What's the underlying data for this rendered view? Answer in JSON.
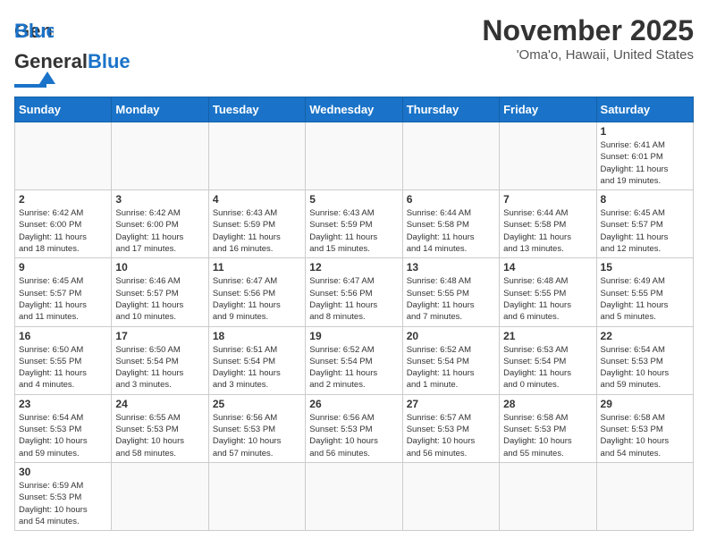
{
  "header": {
    "logo_text_normal": "General",
    "logo_text_blue": "Blue",
    "title": "November 2025",
    "subtitle": "'Oma'o, Hawaii, United States"
  },
  "weekdays": [
    "Sunday",
    "Monday",
    "Tuesday",
    "Wednesday",
    "Thursday",
    "Friday",
    "Saturday"
  ],
  "weeks": [
    [
      {
        "day": "",
        "info": ""
      },
      {
        "day": "",
        "info": ""
      },
      {
        "day": "",
        "info": ""
      },
      {
        "day": "",
        "info": ""
      },
      {
        "day": "",
        "info": ""
      },
      {
        "day": "",
        "info": ""
      },
      {
        "day": "1",
        "info": "Sunrise: 6:41 AM\nSunset: 6:01 PM\nDaylight: 11 hours\nand 19 minutes."
      }
    ],
    [
      {
        "day": "2",
        "info": "Sunrise: 6:42 AM\nSunset: 6:00 PM\nDaylight: 11 hours\nand 18 minutes."
      },
      {
        "day": "3",
        "info": "Sunrise: 6:42 AM\nSunset: 6:00 PM\nDaylight: 11 hours\nand 17 minutes."
      },
      {
        "day": "4",
        "info": "Sunrise: 6:43 AM\nSunset: 5:59 PM\nDaylight: 11 hours\nand 16 minutes."
      },
      {
        "day": "5",
        "info": "Sunrise: 6:43 AM\nSunset: 5:59 PM\nDaylight: 11 hours\nand 15 minutes."
      },
      {
        "day": "6",
        "info": "Sunrise: 6:44 AM\nSunset: 5:58 PM\nDaylight: 11 hours\nand 14 minutes."
      },
      {
        "day": "7",
        "info": "Sunrise: 6:44 AM\nSunset: 5:58 PM\nDaylight: 11 hours\nand 13 minutes."
      },
      {
        "day": "8",
        "info": "Sunrise: 6:45 AM\nSunset: 5:57 PM\nDaylight: 11 hours\nand 12 minutes."
      }
    ],
    [
      {
        "day": "9",
        "info": "Sunrise: 6:45 AM\nSunset: 5:57 PM\nDaylight: 11 hours\nand 11 minutes."
      },
      {
        "day": "10",
        "info": "Sunrise: 6:46 AM\nSunset: 5:57 PM\nDaylight: 11 hours\nand 10 minutes."
      },
      {
        "day": "11",
        "info": "Sunrise: 6:47 AM\nSunset: 5:56 PM\nDaylight: 11 hours\nand 9 minutes."
      },
      {
        "day": "12",
        "info": "Sunrise: 6:47 AM\nSunset: 5:56 PM\nDaylight: 11 hours\nand 8 minutes."
      },
      {
        "day": "13",
        "info": "Sunrise: 6:48 AM\nSunset: 5:55 PM\nDaylight: 11 hours\nand 7 minutes."
      },
      {
        "day": "14",
        "info": "Sunrise: 6:48 AM\nSunset: 5:55 PM\nDaylight: 11 hours\nand 6 minutes."
      },
      {
        "day": "15",
        "info": "Sunrise: 6:49 AM\nSunset: 5:55 PM\nDaylight: 11 hours\nand 5 minutes."
      }
    ],
    [
      {
        "day": "16",
        "info": "Sunrise: 6:50 AM\nSunset: 5:55 PM\nDaylight: 11 hours\nand 4 minutes."
      },
      {
        "day": "17",
        "info": "Sunrise: 6:50 AM\nSunset: 5:54 PM\nDaylight: 11 hours\nand 3 minutes."
      },
      {
        "day": "18",
        "info": "Sunrise: 6:51 AM\nSunset: 5:54 PM\nDaylight: 11 hours\nand 3 minutes."
      },
      {
        "day": "19",
        "info": "Sunrise: 6:52 AM\nSunset: 5:54 PM\nDaylight: 11 hours\nand 2 minutes."
      },
      {
        "day": "20",
        "info": "Sunrise: 6:52 AM\nSunset: 5:54 PM\nDaylight: 11 hours\nand 1 minute."
      },
      {
        "day": "21",
        "info": "Sunrise: 6:53 AM\nSunset: 5:54 PM\nDaylight: 11 hours\nand 0 minutes."
      },
      {
        "day": "22",
        "info": "Sunrise: 6:54 AM\nSunset: 5:53 PM\nDaylight: 10 hours\nand 59 minutes."
      }
    ],
    [
      {
        "day": "23",
        "info": "Sunrise: 6:54 AM\nSunset: 5:53 PM\nDaylight: 10 hours\nand 59 minutes."
      },
      {
        "day": "24",
        "info": "Sunrise: 6:55 AM\nSunset: 5:53 PM\nDaylight: 10 hours\nand 58 minutes."
      },
      {
        "day": "25",
        "info": "Sunrise: 6:56 AM\nSunset: 5:53 PM\nDaylight: 10 hours\nand 57 minutes."
      },
      {
        "day": "26",
        "info": "Sunrise: 6:56 AM\nSunset: 5:53 PM\nDaylight: 10 hours\nand 56 minutes."
      },
      {
        "day": "27",
        "info": "Sunrise: 6:57 AM\nSunset: 5:53 PM\nDaylight: 10 hours\nand 56 minutes."
      },
      {
        "day": "28",
        "info": "Sunrise: 6:58 AM\nSunset: 5:53 PM\nDaylight: 10 hours\nand 55 minutes."
      },
      {
        "day": "29",
        "info": "Sunrise: 6:58 AM\nSunset: 5:53 PM\nDaylight: 10 hours\nand 54 minutes."
      }
    ],
    [
      {
        "day": "30",
        "info": "Sunrise: 6:59 AM\nSunset: 5:53 PM\nDaylight: 10 hours\nand 54 minutes."
      },
      {
        "day": "",
        "info": ""
      },
      {
        "day": "",
        "info": ""
      },
      {
        "day": "",
        "info": ""
      },
      {
        "day": "",
        "info": ""
      },
      {
        "day": "",
        "info": ""
      },
      {
        "day": "",
        "info": ""
      }
    ]
  ]
}
